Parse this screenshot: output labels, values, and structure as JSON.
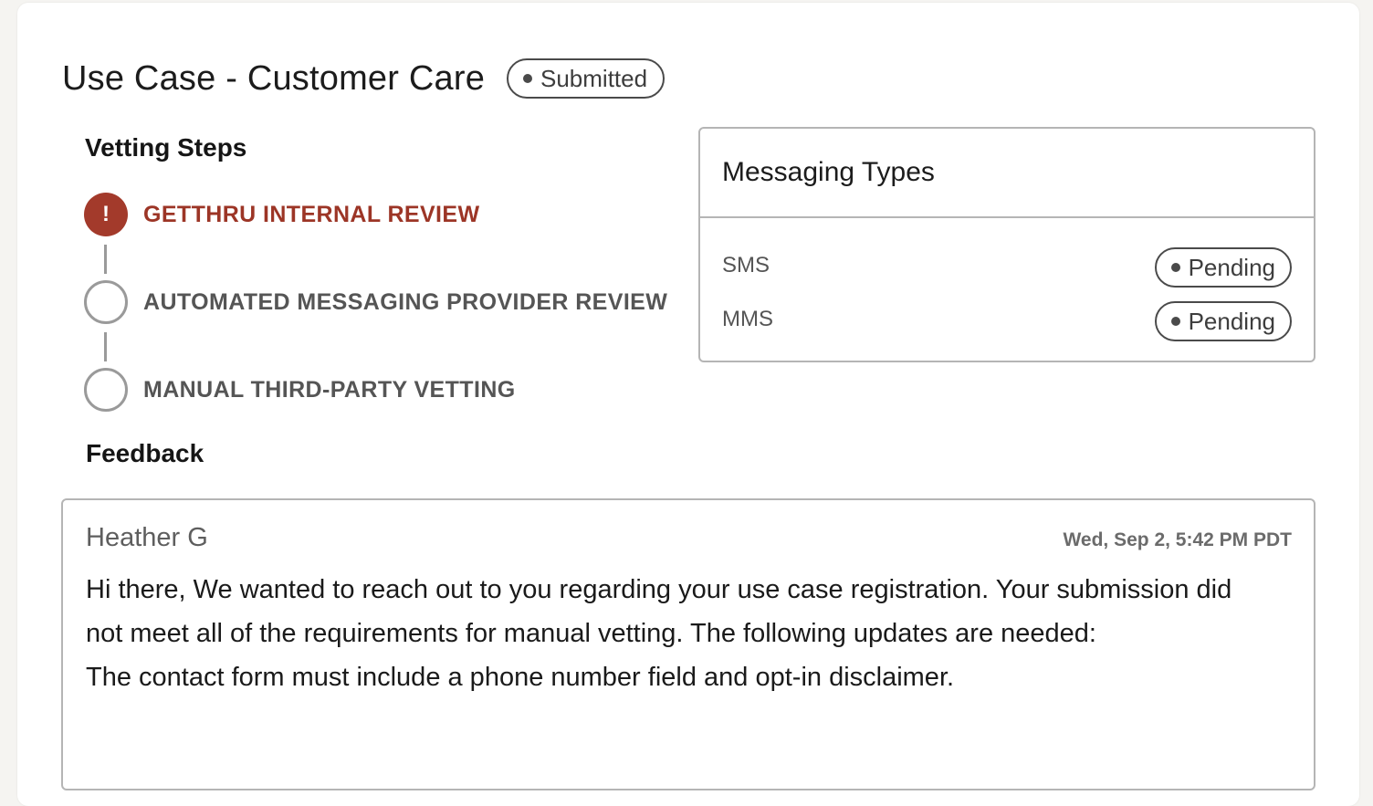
{
  "header": {
    "title": "Use Case - Customer Care",
    "status": "Submitted"
  },
  "vetting": {
    "title": "Vetting Steps",
    "steps": [
      {
        "label": "GETTHRU INTERNAL REVIEW",
        "state": "error",
        "icon": "exclamation-icon"
      },
      {
        "label": "AUTOMATED MESSAGING PROVIDER REVIEW",
        "state": "pending",
        "icon": "empty-circle-icon"
      },
      {
        "label": "MANUAL THIRD-PARTY VETTING",
        "state": "pending",
        "icon": "empty-circle-icon"
      }
    ]
  },
  "messaging_types": {
    "title": "Messaging Types",
    "items": [
      {
        "type": "SMS",
        "status": "Pending"
      },
      {
        "type": "MMS",
        "status": "Pending"
      }
    ]
  },
  "feedback": {
    "title": "Feedback",
    "author": "Heather G",
    "timestamp": "Wed, Sep 2, 5:42 PM PDT",
    "lines": [
      "Hi there, We wanted to reach out to you regarding your use case registration. Your submission did",
      "not meet all of the requirements for manual vetting. The following updates are needed:",
      "The contact form must include a phone number field and opt-in disclaimer."
    ]
  },
  "colors": {
    "error": "#a33a2b",
    "border": "#b5b5b5",
    "pill_border": "#4a4a4a"
  }
}
